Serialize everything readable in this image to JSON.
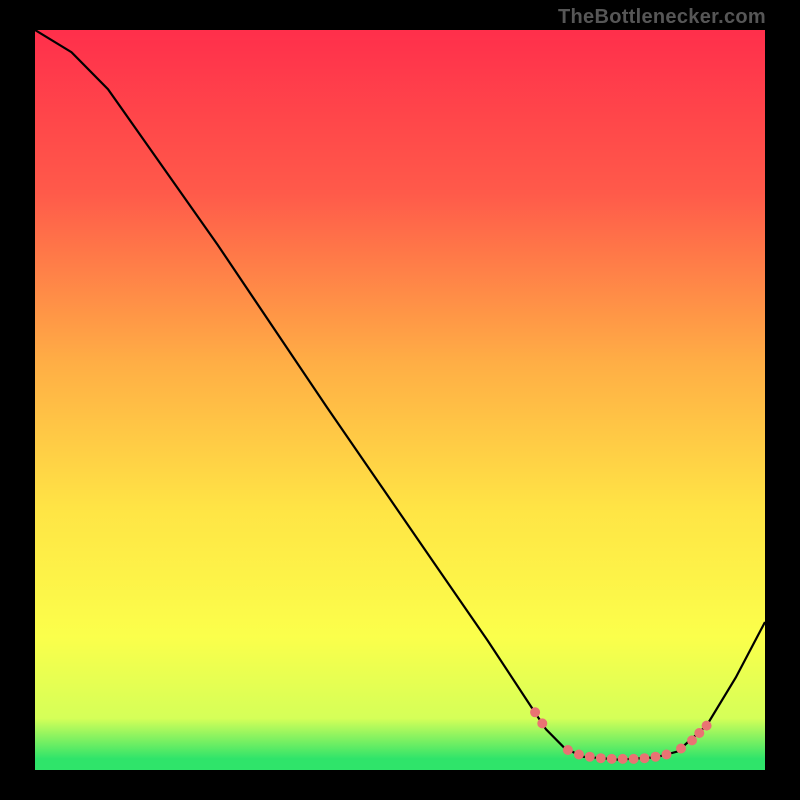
{
  "source_label": "TheBottlenecker.com",
  "colors": {
    "page_bg": "#000000",
    "curve": "#000000",
    "marker": "#e97373",
    "green_band": "#2fe46a",
    "gradient_stops": [
      {
        "offset": 0.0,
        "color": "#ff2f4b"
      },
      {
        "offset": 0.22,
        "color": "#ff5a4a"
      },
      {
        "offset": 0.45,
        "color": "#ffae45"
      },
      {
        "offset": 0.65,
        "color": "#ffe545"
      },
      {
        "offset": 0.82,
        "color": "#fbff4b"
      },
      {
        "offset": 0.93,
        "color": "#d5ff58"
      },
      {
        "offset": 0.985,
        "color": "#2fe46a"
      },
      {
        "offset": 1.0,
        "color": "#2fe46a"
      }
    ]
  },
  "chart_data": {
    "type": "line",
    "title": "",
    "xlabel": "",
    "ylabel": "",
    "xlim": [
      0,
      100
    ],
    "ylim": [
      0,
      100
    ],
    "curve": [
      {
        "x": 0,
        "y": 100
      },
      {
        "x": 5,
        "y": 97
      },
      {
        "x": 10,
        "y": 92
      },
      {
        "x": 15,
        "y": 85
      },
      {
        "x": 25,
        "y": 71
      },
      {
        "x": 40,
        "y": 49
      },
      {
        "x": 55,
        "y": 27.5
      },
      {
        "x": 62,
        "y": 17.5
      },
      {
        "x": 67,
        "y": 10
      },
      {
        "x": 70,
        "y": 5.5
      },
      {
        "x": 72.5,
        "y": 3
      },
      {
        "x": 75,
        "y": 1.8
      },
      {
        "x": 80,
        "y": 1.4
      },
      {
        "x": 85,
        "y": 1.7
      },
      {
        "x": 88,
        "y": 2.5
      },
      {
        "x": 92,
        "y": 6
      },
      {
        "x": 96,
        "y": 12.5
      },
      {
        "x": 100,
        "y": 20
      }
    ],
    "markers": [
      {
        "x": 68.5,
        "y": 7.8
      },
      {
        "x": 69.5,
        "y": 6.3
      },
      {
        "x": 73,
        "y": 2.7
      },
      {
        "x": 74.5,
        "y": 2.1
      },
      {
        "x": 76,
        "y": 1.8
      },
      {
        "x": 77.5,
        "y": 1.6
      },
      {
        "x": 79,
        "y": 1.5
      },
      {
        "x": 80.5,
        "y": 1.5
      },
      {
        "x": 82,
        "y": 1.5
      },
      {
        "x": 83.5,
        "y": 1.6
      },
      {
        "x": 85,
        "y": 1.8
      },
      {
        "x": 86.5,
        "y": 2.1
      },
      {
        "x": 88.5,
        "y": 2.9
      },
      {
        "x": 90,
        "y": 4.0
      },
      {
        "x": 91,
        "y": 5.0
      },
      {
        "x": 92,
        "y": 6.0
      }
    ]
  }
}
